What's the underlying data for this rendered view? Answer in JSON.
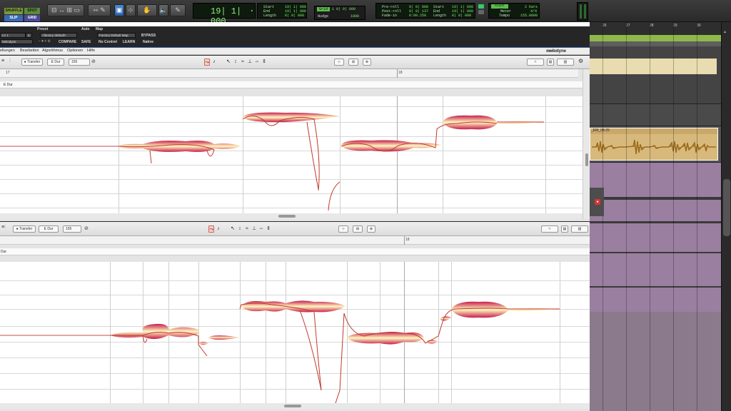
{
  "transport": {
    "modes": [
      "SHUFFLE",
      "SPOT",
      "SLIP",
      "GRID"
    ],
    "counter": "19| 1| 000",
    "sel_labels": [
      "Start",
      "End",
      "Length"
    ],
    "sel_values": [
      "19| 1| 000",
      "19| 1| 000",
      "0| 0| 000"
    ],
    "grid_label": "Grid",
    "grid_value": "1 0| 0| 000",
    "nudge_label": "Nudge",
    "nudge_value": "1000",
    "preroll_labels": [
      "Pre-roll",
      "Post-roll",
      "Fade-in"
    ],
    "preroll_values": [
      "0| 0| 000",
      "0| 0| 137",
      "0:00.250"
    ],
    "play_labels": [
      "Start",
      "End",
      "Length"
    ],
    "play_values": [
      "19| 1| 000",
      "19| 1| 000",
      "0| 0| 000"
    ],
    "countoff_label": "Count Off",
    "countoff_value": "2 bars",
    "meter_label": "Meter",
    "meter_value": "4/4",
    "tempo_label": "Tempo",
    "tempo_value": "155.0000"
  },
  "plugin": {
    "preset_label": "Preset",
    "auto_label": "Auto",
    "map_label": "Map",
    "insert": "LV 1",
    "insert_b": "a",
    "plugin_name": "Melodyne",
    "preset": "<factory default>",
    "map": "Factory Default Map",
    "bypass": "BYPASS",
    "compare": "COMPARE",
    "safe": "SAFE",
    "no_control": "No Control",
    "learn": "LEARN",
    "native": "Native"
  },
  "menu": [
    "ellungen",
    "Bearbeiten",
    "Algorithmus",
    "Optionen",
    "Hilfe"
  ],
  "brand": "melodyne",
  "brand_sub": "studio",
  "win1": {
    "transfer": "Transfer",
    "key": "E Dur",
    "tempo": "155",
    "ruler_a": "17",
    "ruler_b": "18",
    "scale": "E Dur"
  },
  "win2": {
    "transfer": "Transfer",
    "key": "E Dur",
    "tempo": "155",
    "ruler_b": "18",
    "scale": "Dur"
  },
  "timeline": [
    "26",
    "27",
    "28",
    "29",
    "30"
  ],
  "clip_name": "_EM_08-25",
  "colors": {
    "accent": "#3a5fb0",
    "lcd_green": "#7dea6c",
    "blob_outer": "#c81e4b",
    "blob_inner": "#fff7c0",
    "pitch": "#c0392b",
    "track_purple": "#9a7fa0",
    "clip_tan": "#d8b97c"
  }
}
